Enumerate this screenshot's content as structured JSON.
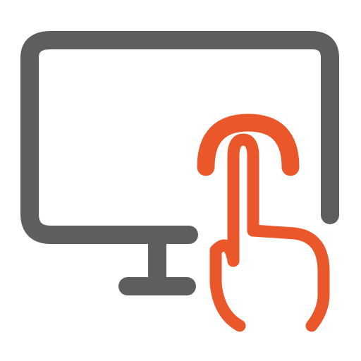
{
  "icon": {
    "name": "touchscreen-monitor-icon",
    "parts": {
      "monitor": "monitor-icon",
      "hand": "pointing-hand-icon",
      "touch_waves": "touch-ripple-icon"
    }
  },
  "colors": {
    "monitor": "#5e5e5e",
    "hand": "#e9572a",
    "background": "#ffffff"
  }
}
